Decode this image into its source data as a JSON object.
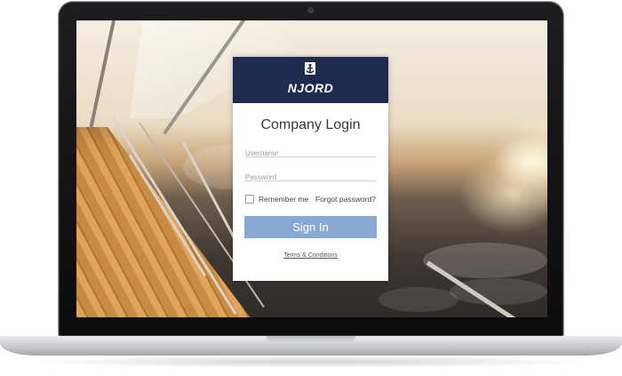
{
  "brand": {
    "name": "NJORD",
    "bar_color": "#1e2b4d",
    "logo_icon": "anchor-icon"
  },
  "login": {
    "title": "Company Login",
    "username_placeholder": "Username",
    "password_placeholder": "Password",
    "remember_label": "Remember me",
    "forgot_label": "Forgot password?",
    "signin_label": "Sign In",
    "signin_color": "#89a9d2",
    "terms_label": "Terms & Conditions"
  }
}
